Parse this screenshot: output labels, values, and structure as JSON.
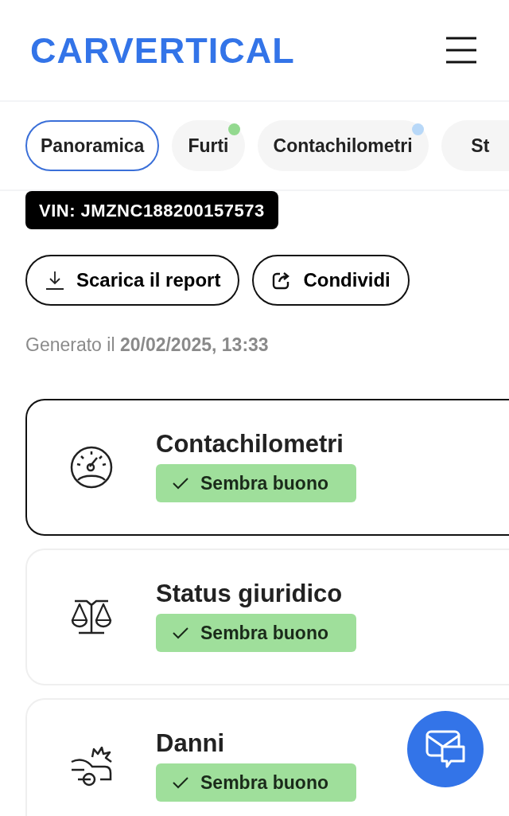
{
  "header": {
    "logo": "CARVERTICAL"
  },
  "tabs": [
    {
      "label": "Panoramica",
      "selected": true
    },
    {
      "label": "Furti",
      "selected": false,
      "color": "#93d98f"
    },
    {
      "label": "Contachilometri",
      "selected": false,
      "color": "#b8d8f8"
    },
    {
      "label": "St",
      "selected": false
    }
  ],
  "vin": "VIN: JMZNC188200157573",
  "actions": [
    {
      "kind": "download",
      "label": "Scarica il report"
    },
    {
      "kind": "share",
      "label": "Condividi"
    }
  ],
  "generated": "Generato il **20/02/2025, 13:33**",
  "sections": [
    {
      "kind": "odometer",
      "title": "Contachilometri",
      "status": "Sembra buono",
      "selected": true
    },
    {
      "kind": "legal",
      "title": "Status giuridico",
      "status": "Sembra buono",
      "selected": false
    },
    {
      "kind": "damage",
      "title": "Danni",
      "status": "Sembra buono",
      "selected": false
    }
  ]
}
